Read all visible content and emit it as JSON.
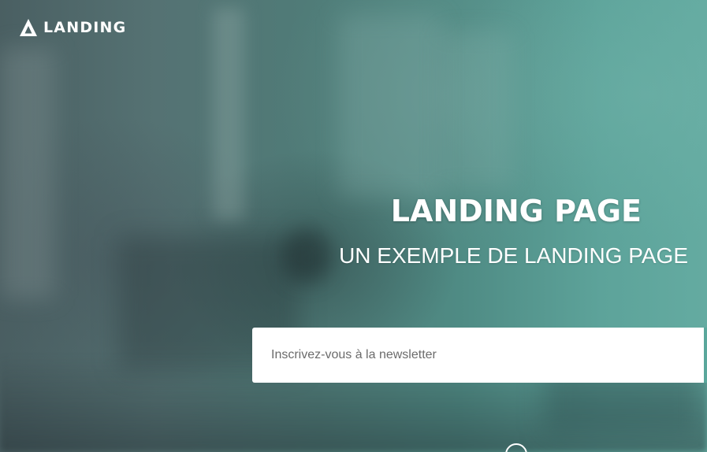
{
  "brand": {
    "logo_icon": "triangle-logo-icon",
    "name": "LANDING"
  },
  "hero": {
    "title": "LANDING PAGE",
    "subtitle": "UN EXEMPLE DE LANDING PAGE"
  },
  "newsletter": {
    "placeholder": "Inscrivez-vous à la newsletter",
    "value": ""
  },
  "scroll": {
    "icon": "scroll-down-circle-icon"
  },
  "colors": {
    "overlay_teal": "#5da39a",
    "text": "#ffffff",
    "input_background": "#ffffff",
    "input_placeholder": "#6b6b6b"
  }
}
